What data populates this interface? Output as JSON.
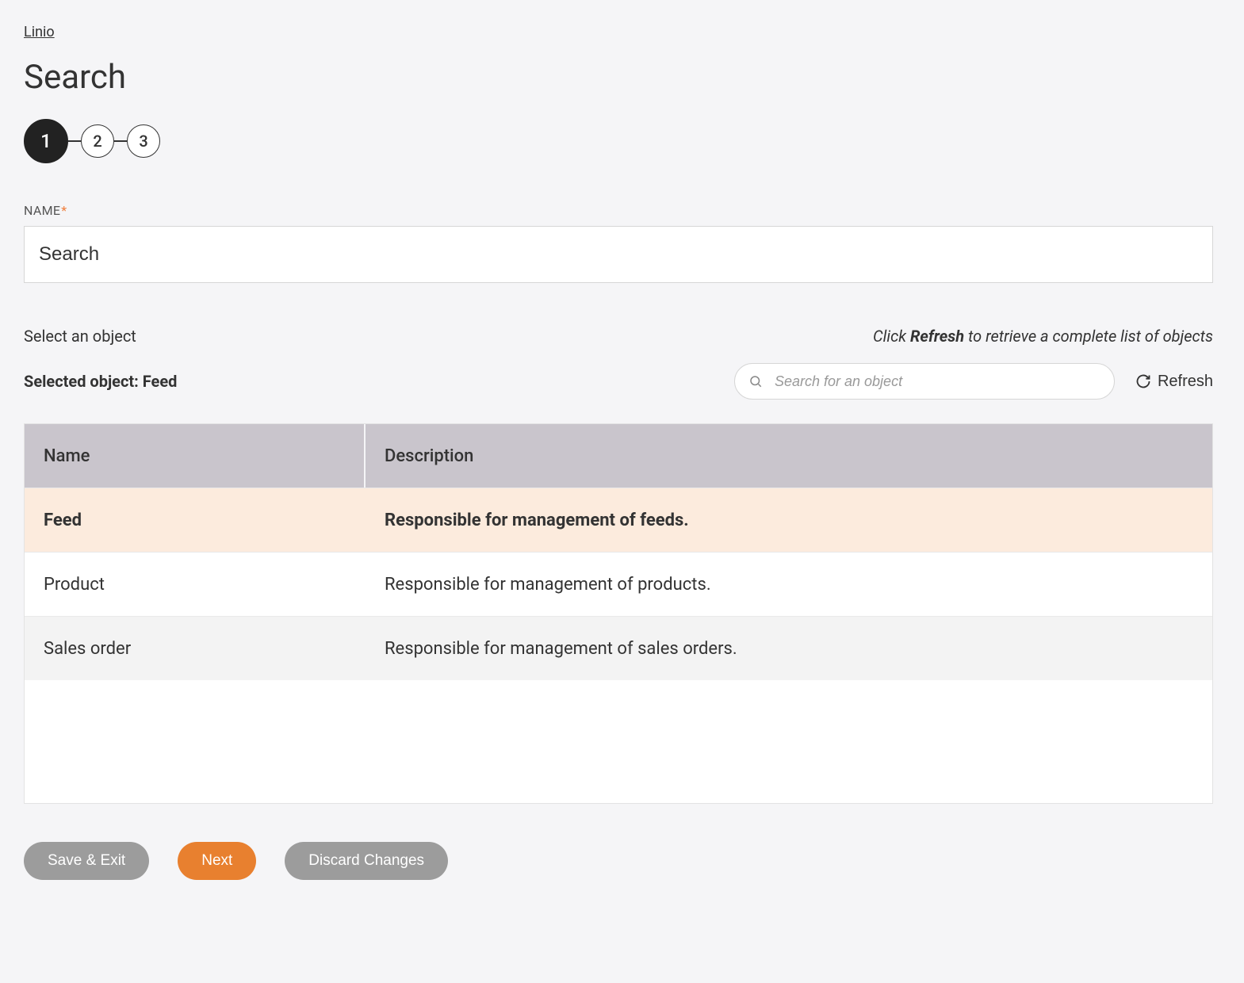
{
  "breadcrumb": "Linio",
  "pageTitle": "Search",
  "steps": [
    "1",
    "2",
    "3"
  ],
  "activeStepIndex": 0,
  "nameField": {
    "label": "NAME",
    "required": "*",
    "value": "Search"
  },
  "objectSection": {
    "selectLabel": "Select an object",
    "hintPrefix": "Click ",
    "hintBold": "Refresh",
    "hintSuffix": " to retrieve a complete list of objects",
    "selectedPrefix": "Selected object: ",
    "selectedValue": "Feed",
    "searchPlaceholder": "Search for an object",
    "refreshLabel": "Refresh"
  },
  "table": {
    "headers": {
      "name": "Name",
      "description": "Description"
    },
    "rows": [
      {
        "name": "Feed",
        "description": "Responsible for management of feeds.",
        "selected": true
      },
      {
        "name": "Product",
        "description": "Responsible for management of products.",
        "selected": false
      },
      {
        "name": "Sales order",
        "description": "Responsible for management of sales orders.",
        "selected": false,
        "alt": true
      }
    ]
  },
  "actions": {
    "saveExit": "Save & Exit",
    "next": "Next",
    "discard": "Discard Changes"
  }
}
